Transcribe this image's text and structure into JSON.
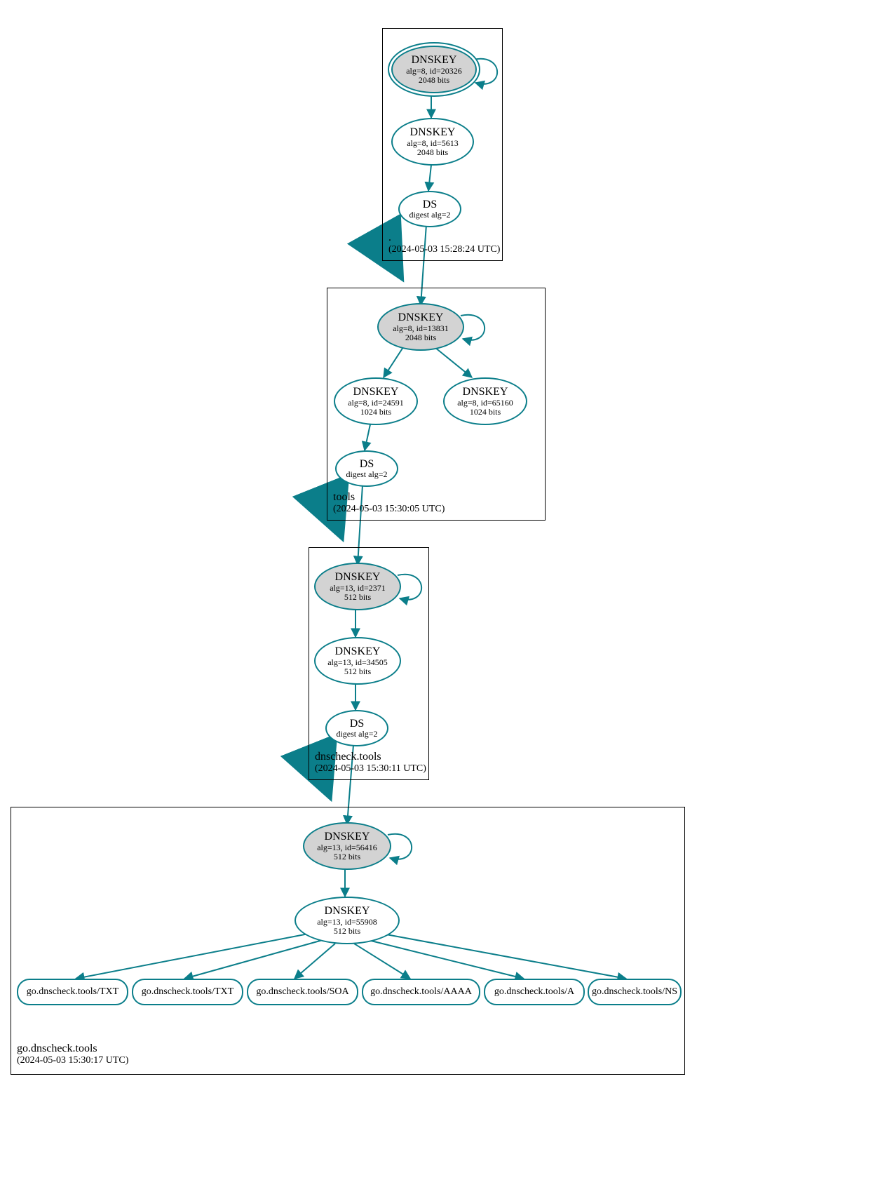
{
  "zones": {
    "root": {
      "name": ".",
      "timestamp": "(2024-05-03 15:28:24 UTC)"
    },
    "tools": {
      "name": "tools",
      "timestamp": "(2024-05-03 15:30:05 UTC)"
    },
    "dnscheck": {
      "name": "dnscheck.tools",
      "timestamp": "(2024-05-03 15:30:11 UTC)"
    },
    "go": {
      "name": "go.dnscheck.tools",
      "timestamp": "(2024-05-03 15:30:17 UTC)"
    }
  },
  "nodes": {
    "root_ksk": {
      "title": "DNSKEY",
      "line2": "alg=8, id=20326",
      "line3": "2048 bits"
    },
    "root_zsk": {
      "title": "DNSKEY",
      "line2": "alg=8, id=5613",
      "line3": "2048 bits"
    },
    "root_ds": {
      "title": "DS",
      "line2": "digest alg=2",
      "line3": ""
    },
    "tools_ksk": {
      "title": "DNSKEY",
      "line2": "alg=8, id=13831",
      "line3": "2048 bits"
    },
    "tools_zsk1": {
      "title": "DNSKEY",
      "line2": "alg=8, id=24591",
      "line3": "1024 bits"
    },
    "tools_zsk2": {
      "title": "DNSKEY",
      "line2": "alg=8, id=65160",
      "line3": "1024 bits"
    },
    "tools_ds": {
      "title": "DS",
      "line2": "digest alg=2",
      "line3": ""
    },
    "dc_ksk": {
      "title": "DNSKEY",
      "line2": "alg=13, id=2371",
      "line3": "512 bits"
    },
    "dc_zsk": {
      "title": "DNSKEY",
      "line2": "alg=13, id=34505",
      "line3": "512 bits"
    },
    "dc_ds": {
      "title": "DS",
      "line2": "digest alg=2",
      "line3": ""
    },
    "go_ksk": {
      "title": "DNSKEY",
      "line2": "alg=13, id=56416",
      "line3": "512 bits"
    },
    "go_zsk": {
      "title": "DNSKEY",
      "line2": "alg=13, id=55908",
      "line3": "512 bits"
    },
    "rr_txt1": {
      "label": "go.dnscheck.tools/TXT"
    },
    "rr_txt2": {
      "label": "go.dnscheck.tools/TXT"
    },
    "rr_soa": {
      "label": "go.dnscheck.tools/SOA"
    },
    "rr_aaaa": {
      "label": "go.dnscheck.tools/AAAA"
    },
    "rr_a": {
      "label": "go.dnscheck.tools/A"
    },
    "rr_ns": {
      "label": "go.dnscheck.tools/NS"
    }
  }
}
